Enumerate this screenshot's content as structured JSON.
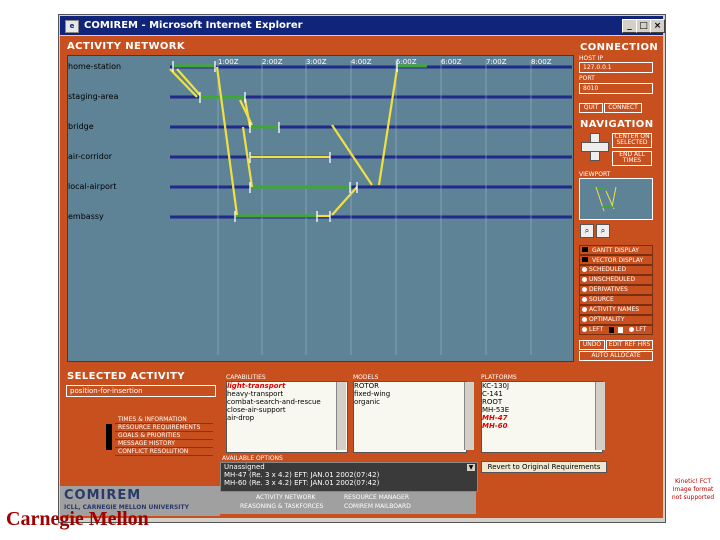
{
  "window": {
    "title": "COMIREM - Microsoft Internet Explorer",
    "min_label": "_",
    "max_label": "□",
    "close_label": "×"
  },
  "activity_network": {
    "title": "ACTIVITY NETWORK",
    "ticks": [
      "1:00Z",
      "2:00Z",
      "3:00Z",
      "4:00Z",
      "5:00Z",
      "6:00Z",
      "7:00Z",
      "8:00Z"
    ],
    "rows": [
      "home-station",
      "staging-area",
      "bridge",
      "air-corridor",
      "local-airport",
      "embassy"
    ]
  },
  "connection": {
    "title": "CONNECTION",
    "host_label": "HOST IP",
    "host_value": "127.0.0.1",
    "port_label": "PORT",
    "port_value": "8010",
    "quit_label": "QUIT",
    "connect_label": "CONNECT"
  },
  "navigation": {
    "title": "NAVIGATION",
    "center_label": "CENTER ON SELECTED",
    "endall_label": "END ALL TIMES",
    "viewport_label": "VIEWPORT"
  },
  "display": {
    "gantt_label": "GANTT DISPLAY",
    "vector_label": "VECTOR DISPLAY",
    "options": [
      "SCHEDULED",
      "UNSCHEDULED",
      "DERIVATIVES",
      "SOURCE",
      "ACTIVITY NAMES",
      "OPTIMALITY"
    ],
    "left_label": "LEFT",
    "right_label": "LFT",
    "undo_label": "UNDO",
    "edit_refs_label": "EDIT REF HRS",
    "auto_allocate_label": "AUTO ALLOCATE"
  },
  "selected_activity": {
    "title": "SELECTED ACTIVITY",
    "value": "position-for-insertion",
    "items": [
      "TIMES & INFORMATION",
      "RESOURCE REQUIREMENTS",
      "GOALS & PRIORITIES",
      "MESSAGE HISTORY",
      "CONFLICT RESOLUTION"
    ]
  },
  "capabilities": {
    "title": "CAPABILITIES",
    "items": [
      {
        "text": "light-transport",
        "highlight": true
      },
      {
        "text": "heavy-transport",
        "highlight": false
      },
      {
        "text": "combat-search-and-rescue",
        "highlight": false
      },
      {
        "text": "close-air-support",
        "highlight": false
      },
      {
        "text": "air-drop",
        "highlight": false
      }
    ]
  },
  "models": {
    "title": "MODELS",
    "items": [
      "ROTOR",
      "fixed-wing",
      "organic"
    ]
  },
  "platforms": {
    "title": "PLATFORMS",
    "items": [
      {
        "text": "KC-130J",
        "highlight": false
      },
      {
        "text": "C-141",
        "highlight": false
      },
      {
        "text": "ROOT",
        "highlight": false
      },
      {
        "text": "MH-53E",
        "highlight": false
      },
      {
        "text": "MH-47",
        "highlight": true
      },
      {
        "text": "MH-60",
        "highlight": true
      }
    ]
  },
  "available_options": {
    "title": "AVAILABLE OPTIONS",
    "selected": "Unassigned",
    "items": [
      "MH-47 (Re. 3 x 4.2) EFT: JAN.01 2002(07:42)",
      "MH-60 (Re. 3 x 4.2) EFT: JAN.01 2002(07:42)"
    ],
    "revert_label": "Revert to Original Requirements"
  },
  "footer": {
    "brand": "COMIREM",
    "sub": "ICLL, CARNEGIE MELLON UNIVERSITY",
    "tabs": [
      "ACTIVITY NETWORK",
      "RESOURCE MANAGER",
      "REASONING & TASKFORCES",
      "COMIREM MAILBOARD"
    ]
  },
  "side_note": "Kinetic! FCT Image format not supported",
  "watermark": "Carnegie Mellon",
  "colors": {
    "app_bg": "#c8501e",
    "chart_bg": "#5e8396",
    "task_bar": "#3ea832",
    "link_line": "#f0e040"
  }
}
